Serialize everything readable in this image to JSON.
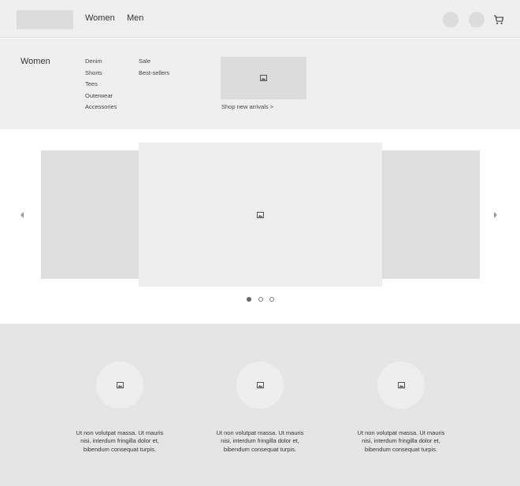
{
  "header": {
    "nav": [
      {
        "label": "Women"
      },
      {
        "label": "Men"
      }
    ],
    "icons": [
      "logo-placeholder",
      "account-icon",
      "wishlist-icon",
      "cart-icon"
    ]
  },
  "mega_menu": {
    "title": "Women",
    "column_1": [
      "Denim",
      "Shorts",
      "Tees",
      "Outerwear",
      "Accessories"
    ],
    "column_2": [
      "Sale",
      "Best-sellers"
    ],
    "promo_link": "Shop new arrivals >"
  },
  "carousel": {
    "active_slide": 1,
    "slide_count": 3
  },
  "features": [
    {
      "text": "Ut non volutpat massa. Ut mauris nisi, interdum fringilla dolor et, bibendum consequat turpis."
    },
    {
      "text": "Ut non volutpat massa. Ut mauris nisi, interdum fringilla dolor et, bibendum consequat turpis."
    },
    {
      "text": "Ut non volutpat massa. Ut mauris nisi, interdum fringilla dolor et, bibendum consequat turpis."
    }
  ],
  "colors": {
    "header_bg": "#efefef",
    "placeholder": "#dcdcdc",
    "section_bg": "#e5e5e5",
    "text": "#333333"
  }
}
